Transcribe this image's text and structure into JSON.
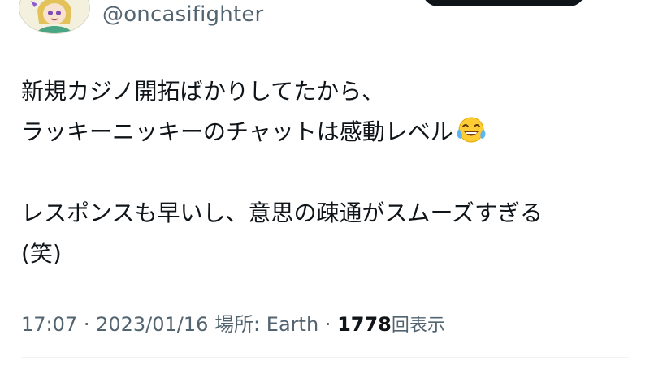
{
  "user": {
    "handle": "@oncasifighter"
  },
  "tweet": {
    "lines": [
      "新規カジノ開拓ばかりしてたから、",
      "ラッキーニッキーのチャットは感動レベル",
      "",
      "レスポンスも早いし、意思の疎通がスムーズすぎる",
      "(笑)"
    ],
    "emoji": "face-with-tears-of-joy"
  },
  "meta": {
    "time": "17:07",
    "separator": "·",
    "date": "2023/01/16",
    "location_label": "場所:",
    "location": "Earth",
    "views": "1778",
    "views_label": "回表示"
  },
  "colors": {
    "text": "#0f1419",
    "secondary": "#536471",
    "divider": "#eff3f4",
    "button": "#0f1419"
  }
}
